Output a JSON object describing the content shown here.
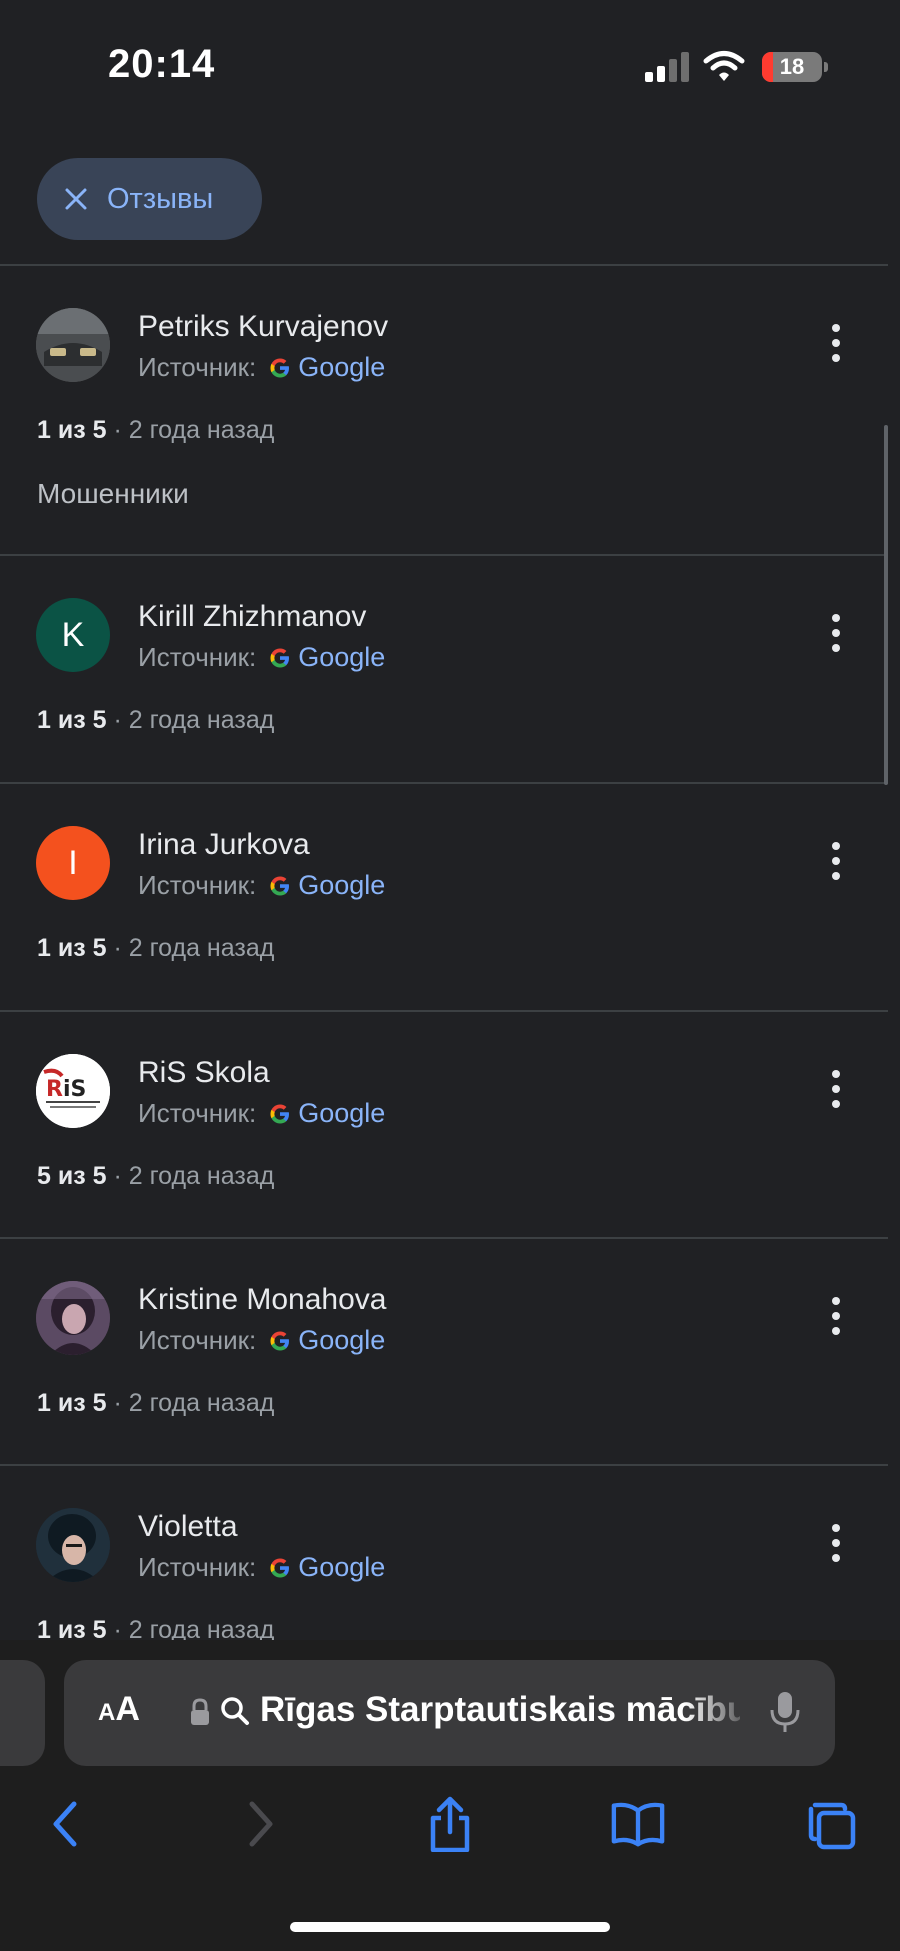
{
  "status_bar": {
    "time": "20:14",
    "battery": "18",
    "battery_level": 0.18
  },
  "filter_chip": {
    "label": "Отзывы",
    "icon": "close-icon"
  },
  "source_label": "Источник:",
  "source_name": "Google",
  "reviews": [
    {
      "author": "Petriks Kurvajenov",
      "rating": "1 из 5",
      "time": "· 2 года назад",
      "text": "Мошенники",
      "avatar_type": "photo-car",
      "avatar_letter": ""
    },
    {
      "author": "Kirill Zhizhmanov",
      "rating": "1 из 5",
      "time": "· 2 года назад",
      "text": "",
      "avatar_type": "letter",
      "avatar_letter": "K",
      "avatar_color": "#0b5345"
    },
    {
      "author": "Irina Jurkova",
      "rating": "1 из 5",
      "time": "· 2 года назад",
      "text": "",
      "avatar_type": "letter",
      "avatar_letter": "I",
      "avatar_color": "#f4511e"
    },
    {
      "author": "RiS Skola",
      "rating": "5 из 5",
      "time": "· 2 года назад",
      "text": "",
      "avatar_type": "logo-ris",
      "avatar_letter": ""
    },
    {
      "author": "Kristine Monahova",
      "rating": "1 из 5",
      "time": "· 2 года назад",
      "text": "",
      "avatar_type": "photo-portrait",
      "avatar_letter": ""
    },
    {
      "author": "Violetta",
      "rating": "1 из 5",
      "time": "· 2 года назад",
      "text": "",
      "avatar_type": "photo-portrait-2",
      "avatar_letter": ""
    }
  ],
  "browser": {
    "aa_small": "A",
    "aa_big": "A",
    "url_text": "Rīgas Starptautiskais mācību centrs",
    "toolbar": [
      "back-icon",
      "forward-icon",
      "share-icon",
      "bookmarks-icon",
      "tabs-icon"
    ]
  }
}
